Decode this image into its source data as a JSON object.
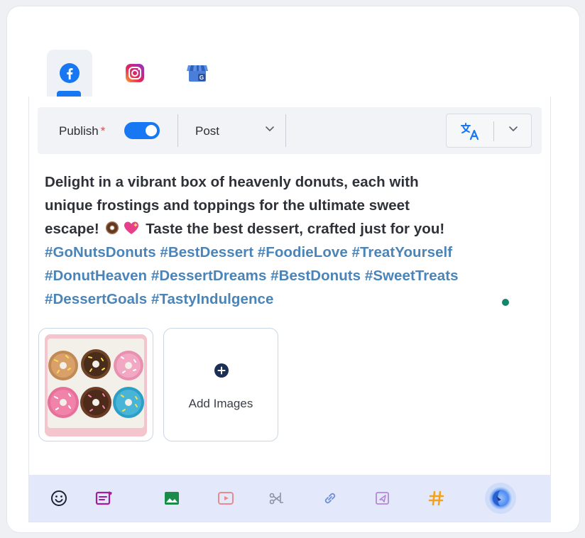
{
  "tabs": [
    {
      "name": "Facebook",
      "icon": "facebook-icon",
      "active": true
    },
    {
      "name": "Instagram",
      "icon": "instagram-icon",
      "active": false
    },
    {
      "name": "Google Business",
      "icon": "google-business-icon",
      "active": false
    }
  ],
  "toolbar": {
    "publish_label": "Publish",
    "required_mark": "*",
    "publish_enabled": true,
    "post_type": "Post",
    "translate_icon": "translate-icon"
  },
  "post": {
    "body_line1": "Delight in a vibrant box of heavenly donuts, each with",
    "body_line2": "unique frostings and toppings for the ultimate sweet",
    "body_line3_pre": "escape!",
    "body_line3_post": "Taste the best dessert, crafted just for you!",
    "hashtags_line1": "#GoNutsDonuts #BestDessert #FoodieLove #TreatYourself",
    "hashtags_line2": "#DonutHeaven #DessertDreams #BestDonuts #SweetTreats",
    "hashtags_line3": "#DessertGoals #TastyIndulgence"
  },
  "media": {
    "thumbnail": "donut-box-image",
    "add_label": "Add Images"
  },
  "bottom_tools": [
    "emoji-icon",
    "caption-icon",
    "image-icon",
    "video-icon",
    "crop-icon",
    "link-icon",
    "send-icon",
    "hashtag-icon",
    "ai-assistant-icon"
  ],
  "colors": {
    "accent": "#1877f2",
    "hashtag": "#4a84b9",
    "bottom_bar": "#e3e9fb",
    "status_dot": "#16866a"
  }
}
